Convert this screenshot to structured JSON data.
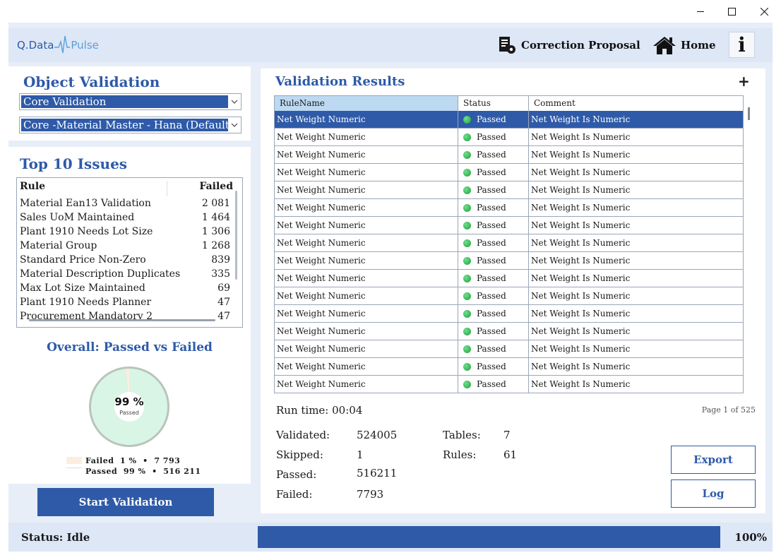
{
  "window": {
    "controls": [
      "minimize-icon",
      "maximize-icon",
      "close-icon"
    ]
  },
  "header": {
    "logo_part1": "Q.Data",
    "logo_part2": "Pulse",
    "correction_label": "Correction Proposal",
    "home_label": "Home",
    "info_label": "i"
  },
  "object_validation": {
    "title": "Object Validation",
    "validation_type": "Core Validation",
    "object_set": "Core -Material Master - Hana (Default"
  },
  "top_issues": {
    "title": "Top 10 Issues",
    "col_rule": "Rule",
    "col_failed": "Failed",
    "rows": [
      {
        "rule": "Material Ean13 Validation",
        "failed": "2 081"
      },
      {
        "rule": "Sales UoM Maintained",
        "failed": "1 464"
      },
      {
        "rule": "Plant 1910 Needs Lot Size",
        "failed": "1 306"
      },
      {
        "rule": "Material Group",
        "failed": "1 268"
      },
      {
        "rule": "Standard Price Non-Zero",
        "failed": "839"
      },
      {
        "rule": "Material Description Duplicates",
        "failed": "335"
      },
      {
        "rule": "Max Lot Size Maintained",
        "failed": "69"
      },
      {
        "rule": "Plant 1910 Needs Planner",
        "failed": "47"
      },
      {
        "rule": "Procurement Mandatory 2",
        "failed": "47"
      }
    ]
  },
  "overall": {
    "title": "Overall: Passed vs Failed",
    "center_value": "99 %",
    "center_label": "Passed",
    "legend_failed": "Failed  1 %  •  7 793",
    "legend_passed": "Passed  99 %  •  516 211",
    "passed_fraction": 0.9853,
    "colors": {
      "passed": "#d9f5e6",
      "failed": "#fbeee0",
      "ring": "#b9c4bd"
    }
  },
  "start_button": "Start Validation",
  "results": {
    "title": "Validation Results",
    "add_label": "+",
    "columns": [
      "RuleName",
      "Status",
      "Comment"
    ],
    "rows": [
      {
        "rule": "Net Weight Numeric",
        "status": "Passed",
        "comment": "Net Weight Is Numeric"
      },
      {
        "rule": "Net Weight Numeric",
        "status": "Passed",
        "comment": "Net Weight Is Numeric"
      },
      {
        "rule": "Net Weight Numeric",
        "status": "Passed",
        "comment": "Net Weight Is Numeric"
      },
      {
        "rule": "Net Weight Numeric",
        "status": "Passed",
        "comment": "Net Weight Is Numeric"
      },
      {
        "rule": "Net Weight Numeric",
        "status": "Passed",
        "comment": "Net Weight Is Numeric"
      },
      {
        "rule": "Net Weight Numeric",
        "status": "Passed",
        "comment": "Net Weight Is Numeric"
      },
      {
        "rule": "Net Weight Numeric",
        "status": "Passed",
        "comment": "Net Weight Is Numeric"
      },
      {
        "rule": "Net Weight Numeric",
        "status": "Passed",
        "comment": "Net Weight Is Numeric"
      },
      {
        "rule": "Net Weight Numeric",
        "status": "Passed",
        "comment": "Net Weight Is Numeric"
      },
      {
        "rule": "Net Weight Numeric",
        "status": "Passed",
        "comment": "Net Weight Is Numeric"
      },
      {
        "rule": "Net Weight Numeric",
        "status": "Passed",
        "comment": "Net Weight Is Numeric"
      },
      {
        "rule": "Net Weight Numeric",
        "status": "Passed",
        "comment": "Net Weight Is Numeric"
      },
      {
        "rule": "Net Weight Numeric",
        "status": "Passed",
        "comment": "Net Weight Is Numeric"
      },
      {
        "rule": "Net Weight Numeric",
        "status": "Passed",
        "comment": "Net Weight Is Numeric"
      },
      {
        "rule": "Net Weight Numeric",
        "status": "Passed",
        "comment": "Net Weight Is Numeric"
      },
      {
        "rule": "Net Weight Numeric",
        "status": "Passed",
        "comment": "Net Weight Is Numeric"
      }
    ],
    "run_time": "Run time: 00:04",
    "page_info": "Page 1 of 525"
  },
  "stats": {
    "validated_label": "Validated:",
    "validated_value": "524005",
    "skipped_label": "Skipped:",
    "skipped_value": "1",
    "passed_label": "Passed:",
    "passed_value": "516211",
    "failed_label": "Failed:",
    "failed_value": "7793",
    "tables_label": "Tables:",
    "tables_value": "7",
    "rules_label": "Rules:",
    "rules_value": "61"
  },
  "actions": {
    "export": "Export",
    "log": "Log"
  },
  "status": {
    "text": "Status: Idle",
    "progress_label": "100%",
    "progress_fraction": 1.0
  }
}
